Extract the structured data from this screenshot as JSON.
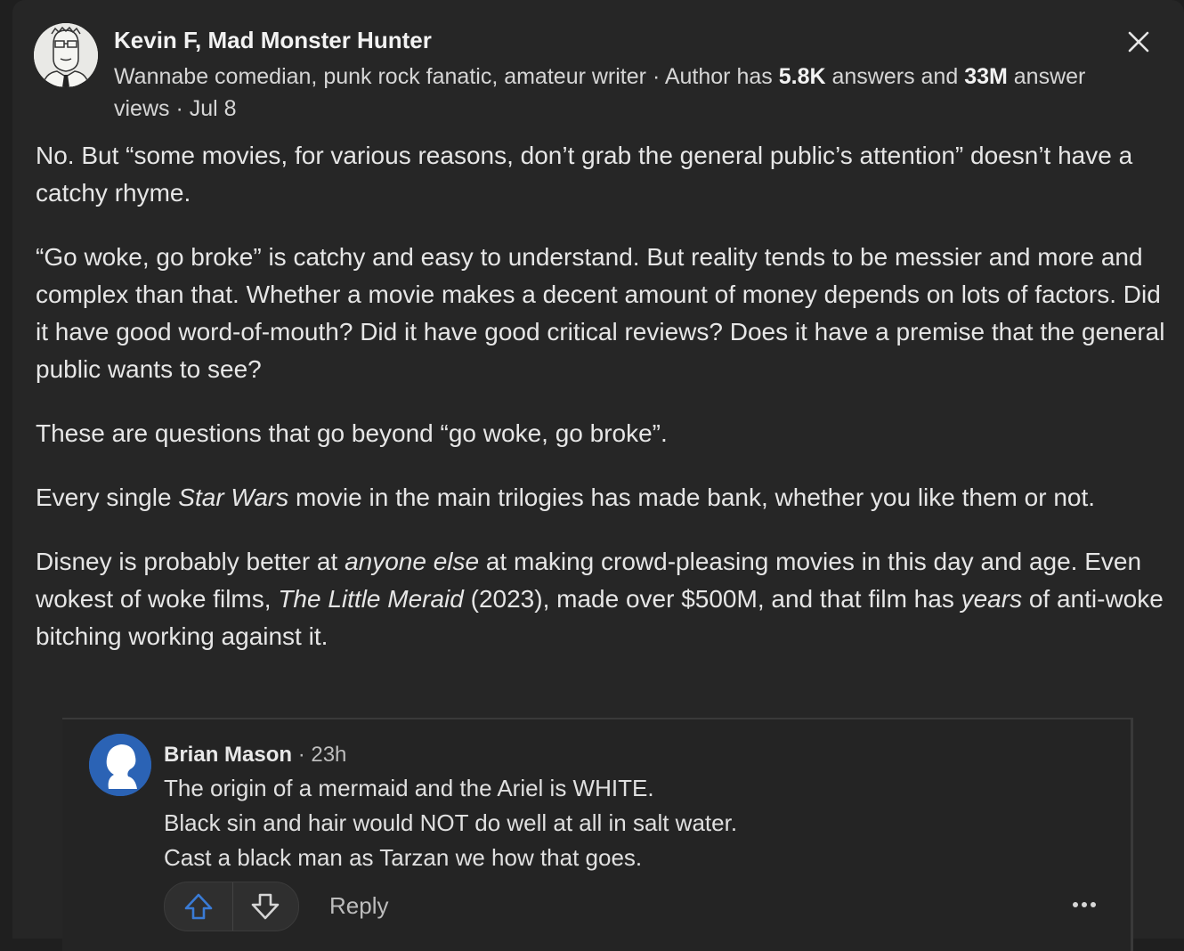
{
  "author": {
    "name": "Kevin F, Mad Monster Hunter",
    "bio": "Wannabe comedian, punk rock fanatic, amateur writer",
    "separator": "·",
    "stats_prefix": "Author has",
    "answers_count": "5.8K",
    "answers_suffix": "answers and",
    "views_count": "33M",
    "views_suffix": "answer views",
    "date": "Jul 8",
    "avatar_icon": "cartoon-man-glasses-avatar"
  },
  "close": {
    "icon": "close-icon"
  },
  "answer": {
    "p1": "No. But “some movies, for various reasons, don’t grab the general public’s attention” doesn’t have a catchy rhyme.",
    "p2": "“Go woke, go broke” is catchy and easy to understand. But reality tends to be messier and more and complex than that. Whether a movie makes a decent amount of money depends on lots of factors. Did it have good word-of-mouth? Did it have good critical reviews? Does it have a premise that the general public wants to see?",
    "p3": "These are questions that go beyond “go woke, go broke”.",
    "p4_a": "Every single ",
    "p4_em": "Star Wars",
    "p4_b": " movie in the main trilogies has made bank, whether you like them or not.",
    "p5_a": "Disney is probably better at ",
    "p5_em1": "anyone else",
    "p5_b": " at making crowd-pleasing movies in this day and age. Even wokest of woke films, ",
    "p5_em2": "The Little Meraid",
    "p5_c": " (2023), made over $500M, and that film has ",
    "p5_em3": "years",
    "p5_d": " of anti-woke bitching working against it."
  },
  "comment": {
    "author": "Brian Mason",
    "separator": " · ",
    "time": "23h",
    "lines": [
      "The origin of a mermaid and the Ariel is WHITE.",
      "Black sin and hair would NOT do well at all in salt water.",
      "Cast a black man as Tarzan we how that goes."
    ],
    "reply_label": "Reply",
    "upvote_icon": "upvote-arrow-icon",
    "downvote_icon": "downvote-arrow-icon",
    "more_icon": "more-dots-icon",
    "avatar_icon": "default-profile-silhouette",
    "upvote_color": "#3a7bd5"
  }
}
